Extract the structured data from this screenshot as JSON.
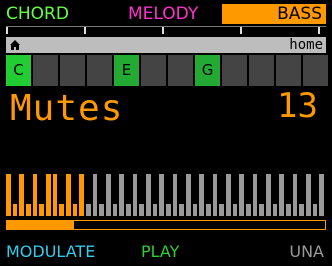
{
  "tabs": {
    "chord": "CHORD",
    "melody": "MELODY",
    "bass": "BASS",
    "active": "bass"
  },
  "location": {
    "icon": "home-icon",
    "label": "home"
  },
  "keys": [
    {
      "label": "C",
      "state": "root"
    },
    {
      "label": "",
      "state": "off"
    },
    {
      "label": "",
      "state": "off"
    },
    {
      "label": "",
      "state": "off"
    },
    {
      "label": "E",
      "state": "on"
    },
    {
      "label": "",
      "state": "off"
    },
    {
      "label": "",
      "state": "off"
    },
    {
      "label": "G",
      "state": "on"
    },
    {
      "label": "",
      "state": "off"
    },
    {
      "label": "",
      "state": "off"
    },
    {
      "label": "",
      "state": "off"
    },
    {
      "label": "",
      "state": "off"
    }
  ],
  "parameter": {
    "name": "Mutes",
    "value": "13"
  },
  "steps": [
    "tall",
    "short",
    "tall",
    "short",
    "tall",
    "short",
    "tall",
    "tall",
    "short",
    "tall",
    "short",
    "tall",
    "short",
    "tall",
    "short",
    "tall",
    "short",
    "tall",
    "short",
    "tall",
    "short",
    "tall",
    "short",
    "tall",
    "short",
    "tall",
    "short",
    "tall",
    "short",
    "tall",
    "short",
    "tall",
    "short",
    "tall",
    "short",
    "tall",
    "short",
    "tall",
    "short",
    "tall",
    "short",
    "tall",
    "short",
    "tall",
    "short",
    "tall",
    "short",
    "tall"
  ],
  "steps_active_count": 12,
  "progress": 0.21,
  "buttons": {
    "modulate": "MODULATE",
    "play": "PLAY",
    "una": "UNA"
  },
  "colors": {
    "orange": "#ff9900",
    "gray": "#9a9a9a",
    "green": "#22aa33",
    "magenta": "#ff33cc",
    "cyan": "#33ccee"
  }
}
